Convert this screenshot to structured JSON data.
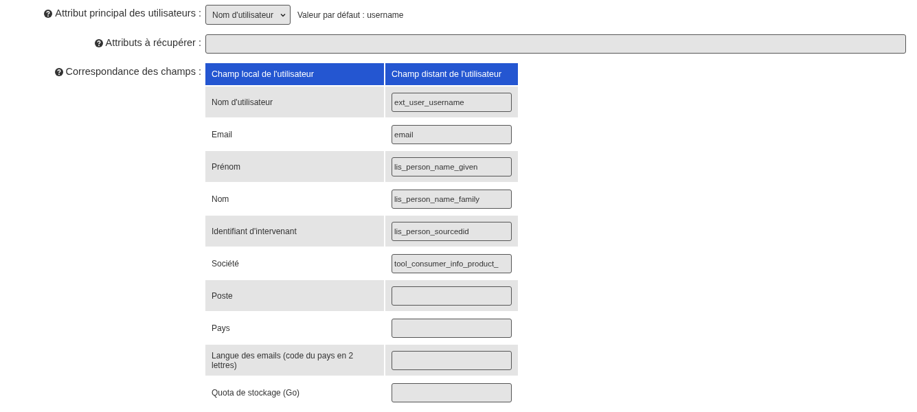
{
  "form_rows": [
    {
      "kind": "select",
      "label": "Attribut principal des utilisateurs :",
      "value": "Nom d'utilisateur",
      "hint": "Valeur par défaut : username"
    },
    {
      "kind": "text",
      "label": "Attributs à récupérer :",
      "value": ""
    },
    {
      "kind": "mapping",
      "label": "Correspondance des champs :"
    }
  ],
  "mapping_table": {
    "columns": [
      "Champ local de l'utilisateur",
      "Champ distant de l'utilisateur"
    ],
    "rows": [
      {
        "local": "Nom d'utilisateur",
        "remote": "ext_user_username"
      },
      {
        "local": "Email",
        "remote": "email"
      },
      {
        "local": "Prénom",
        "remote": "lis_person_name_given"
      },
      {
        "local": "Nom",
        "remote": "lis_person_name_family"
      },
      {
        "local": "Identifiant d'intervenant",
        "remote": "lis_person_sourcedid"
      },
      {
        "local": "Société",
        "remote": "tool_consumer_info_product_"
      },
      {
        "local": "Poste",
        "remote": ""
      },
      {
        "local": "Pays",
        "remote": ""
      },
      {
        "local": "Langue des emails (code du pays en 2 lettres)",
        "remote": ""
      },
      {
        "local": "Quota de stockage (Go)",
        "remote": ""
      }
    ]
  }
}
